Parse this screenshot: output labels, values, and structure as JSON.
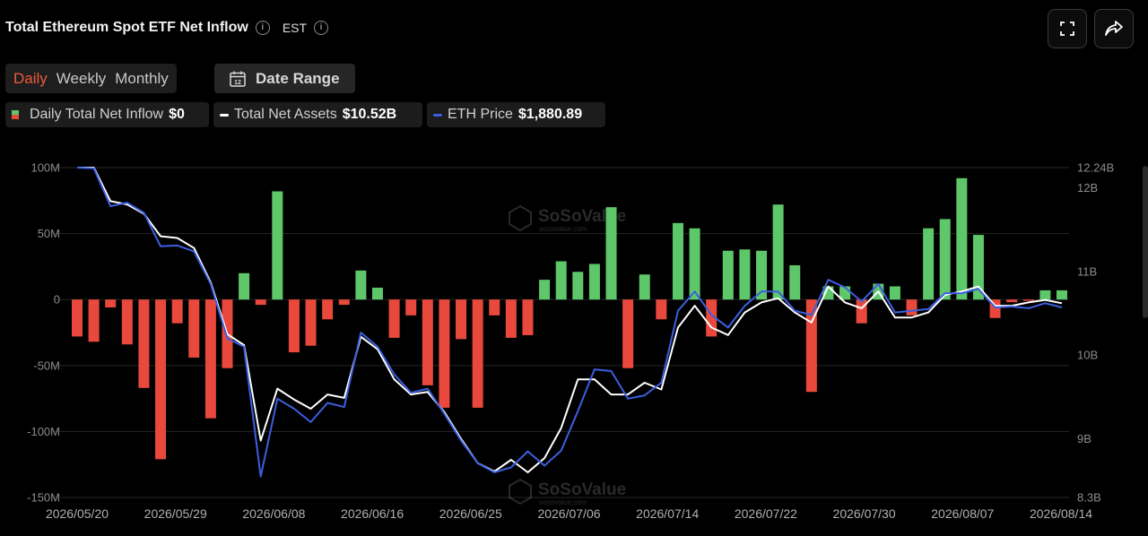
{
  "header": {
    "title": "Total Ethereum Spot ETF Net Inflow",
    "timezone": "EST",
    "info_glyph": "i"
  },
  "tabs": [
    {
      "label": "Daily",
      "active": true
    },
    {
      "label": "Weekly",
      "active": false
    },
    {
      "label": "Monthly",
      "active": false
    }
  ],
  "date_range": {
    "label": "Date Range",
    "icon": "calendar-icon",
    "icon_text": "12"
  },
  "legend": {
    "inflow": {
      "label": "Daily Total Net Inflow",
      "value": "$0"
    },
    "assets": {
      "label": "Total Net Assets",
      "value": "$10.52B"
    },
    "price": {
      "label": "ETH Price",
      "value": "$1,880.89"
    }
  },
  "watermark": {
    "brand": "SoSoValue",
    "sub": "sosovalue.com"
  },
  "colors": {
    "positive": "#5ec76a",
    "negative": "#e8493c",
    "assets_line": "#ffffff",
    "price_line": "#3b5fe0",
    "accent": "#ef5b3e",
    "grid": "#262626",
    "axis_text": "#8c8c8c"
  },
  "chart_data": {
    "type": "bar",
    "x_tick_labels": [
      "2026/05/20",
      "2026/05/29",
      "2026/06/08",
      "2026/06/16",
      "2026/06/25",
      "2026/07/06",
      "2026/07/14",
      "2026/07/22",
      "2026/07/30",
      "2026/08/07",
      "2026/08/14"
    ],
    "y_left": {
      "ticks": [
        100,
        50,
        0,
        -50,
        -100,
        -150
      ],
      "tick_labels": [
        "100M",
        "50M",
        "0",
        "-50M",
        "-100M",
        "-150M"
      ],
      "range": [
        -150,
        100
      ],
      "unit": "M"
    },
    "y_right": {
      "ticks": [
        12.24,
        12,
        11,
        10,
        9,
        8.3
      ],
      "tick_labels": [
        "12.24B",
        "12B",
        "11B",
        "10B",
        "9B",
        "8.3B"
      ],
      "range": [
        8.3,
        12.24
      ],
      "unit": "B"
    },
    "grid": true,
    "series": [
      {
        "name": "Daily Total Net Inflow",
        "type": "bar",
        "values": [
          -28,
          -32,
          -6,
          -34,
          -67,
          -121,
          -18,
          -44,
          -90,
          -52,
          20,
          -4,
          82,
          -40,
          -35,
          -15,
          -4,
          22,
          9,
          -29,
          -12,
          -65,
          -82,
          -30,
          -82,
          -12,
          -29,
          -27,
          15,
          29,
          21,
          27,
          70,
          -52,
          19,
          -15,
          58,
          54,
          -28,
          37,
          38,
          37,
          72,
          26,
          -70,
          10,
          10,
          -18,
          12,
          10,
          -12,
          54,
          61,
          92,
          49,
          -14,
          -2,
          -1,
          7,
          7
        ],
        "unit": "M"
      },
      {
        "name": "Total Net Assets",
        "type": "line",
        "values": [
          12.24,
          12.24,
          11.84,
          11.8,
          11.69,
          11.42,
          11.4,
          11.28,
          10.87,
          10.25,
          10.12,
          8.98,
          9.6,
          9.47,
          9.36,
          9.53,
          9.49,
          10.22,
          10.07,
          9.71,
          9.53,
          9.56,
          9.32,
          9.0,
          8.71,
          8.61,
          8.75,
          8.6,
          8.77,
          9.13,
          9.71,
          9.71,
          9.53,
          9.53,
          9.67,
          9.59,
          10.33,
          10.59,
          10.33,
          10.24,
          10.51,
          10.63,
          10.68,
          10.51,
          10.39,
          10.82,
          10.63,
          10.56,
          10.76,
          10.45,
          10.45,
          10.51,
          10.72,
          10.76,
          10.82,
          10.59,
          10.59,
          10.63,
          10.66,
          10.62
        ]
      },
      {
        "name": "ETH Price",
        "type": "line",
        "values": [
          12.24,
          12.23,
          11.78,
          11.82,
          11.7,
          11.3,
          11.31,
          11.24,
          10.85,
          10.2,
          10.1,
          8.55,
          9.48,
          9.36,
          9.2,
          9.43,
          9.38,
          10.27,
          10.1,
          9.77,
          9.55,
          9.6,
          9.3,
          8.98,
          8.71,
          8.6,
          8.66,
          8.85,
          8.68,
          8.86,
          9.33,
          9.83,
          9.81,
          9.48,
          9.52,
          9.67,
          10.53,
          10.76,
          10.48,
          10.33,
          10.59,
          10.76,
          10.76,
          10.53,
          10.48,
          10.9,
          10.81,
          10.64,
          10.85,
          10.51,
          10.53,
          10.55,
          10.74,
          10.74,
          10.79,
          10.57,
          10.58,
          10.56,
          10.62,
          10.57
        ]
      }
    ]
  }
}
